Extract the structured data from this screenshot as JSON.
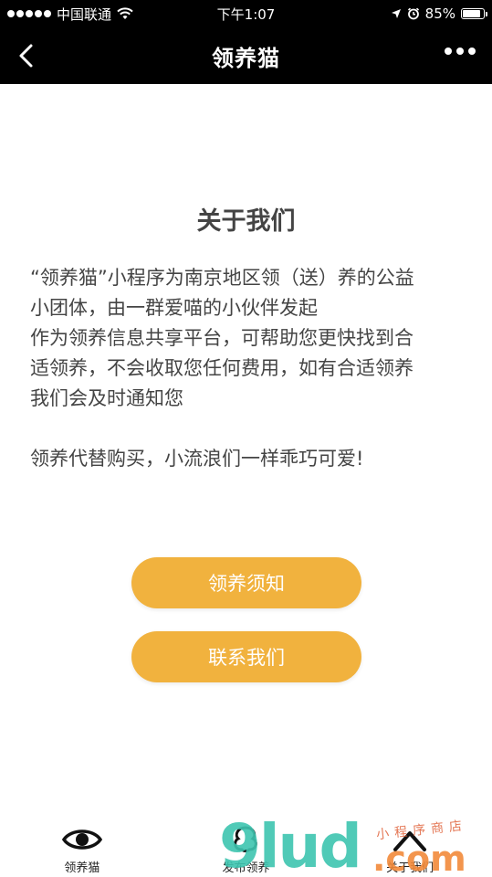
{
  "status_bar": {
    "carrier": "中国联通",
    "time": "下午1:07",
    "battery_text": "85%",
    "battery_level": 0.85
  },
  "nav": {
    "title": "领养猫"
  },
  "about": {
    "title": "关于我们",
    "lines": [
      "“领养猫”小程序为南京地区领（送）养的公益",
      "小团体，由一群爱喵的小伙伴发起",
      "作为领养信息共享平台，可帮助您更快找到合",
      "适领养，不会收取您任何费用，如有合适领养",
      "我们会及时通知您"
    ],
    "closing": "领养代替购买，小流浪们一样乖巧可爱!"
  },
  "buttons": {
    "notice": "领养须知",
    "contact": "联系我们"
  },
  "tabs": [
    {
      "label": "领养猫",
      "icon": "eye-icon"
    },
    {
      "label": "发布领养",
      "icon": "publish-icon"
    },
    {
      "label": "关于我们",
      "icon": "up-arrow-icon"
    }
  ],
  "watermark": {
    "main": "9lud",
    "domain": ".com",
    "caption": "小程序商店"
  },
  "colors": {
    "accent": "#f1b23e",
    "bar_bg": "#000000"
  }
}
